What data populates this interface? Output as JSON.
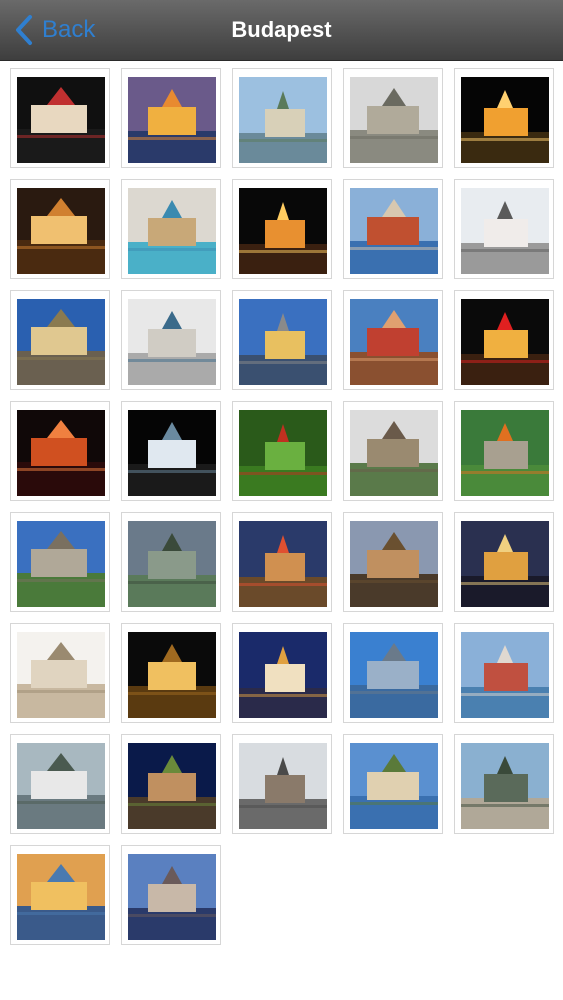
{
  "navbar": {
    "back_label": "Back",
    "title": "Budapest",
    "accent": "#2f7fd0"
  },
  "gallery": {
    "photos": [
      {
        "name": "parliament-night",
        "sky": "#101010",
        "ground": "#1a1a1a",
        "main": "#e8d8c0",
        "accent": "#c03030"
      },
      {
        "name": "danube-dusk",
        "sky": "#6a5a8a",
        "ground": "#2a3a6a",
        "main": "#f0b040",
        "accent": "#e88a30"
      },
      {
        "name": "buda-castle-river",
        "sky": "#9cc0e0",
        "ground": "#6a8a9a",
        "main": "#d8d0b8",
        "accent": "#5a7a5a"
      },
      {
        "name": "stone-tower",
        "sky": "#d8d8d8",
        "ground": "#8a8a80",
        "main": "#b0aa9a",
        "accent": "#6a6a60"
      },
      {
        "name": "matthias-church-night",
        "sky": "#050505",
        "ground": "#3a2a10",
        "main": "#f0a030",
        "accent": "#ffd070"
      },
      {
        "name": "gellert-baths-night",
        "sky": "#2a1a10",
        "ground": "#4a2a10",
        "main": "#f0c070",
        "accent": "#d08030"
      },
      {
        "name": "szechenyi-baths",
        "sky": "#dcd8d0",
        "ground": "#4ab0c8",
        "main": "#c8a878",
        "accent": "#3a8ab0"
      },
      {
        "name": "st-stephens-basilica-night",
        "sky": "#080808",
        "ground": "#3a2010",
        "main": "#e89030",
        "accent": "#ffcc60"
      },
      {
        "name": "river-panorama",
        "sky": "#8ab0d8",
        "ground": "#3a70b0",
        "main": "#c05030",
        "accent": "#d8c8b0"
      },
      {
        "name": "white-church",
        "sky": "#e8ecf0",
        "ground": "#9a9a9a",
        "main": "#f0ecea",
        "accent": "#5a5a5a"
      },
      {
        "name": "heroes-square-colonnade",
        "sky": "#2a60b0",
        "ground": "#6a6050",
        "main": "#e0c890",
        "accent": "#8a7a50"
      },
      {
        "name": "museum-columns",
        "sky": "#e8e8e8",
        "ground": "#aaaaaa",
        "main": "#d0ccc4",
        "accent": "#3a6a8a"
      },
      {
        "name": "modern-building-river",
        "sky": "#3a70c0",
        "ground": "#3a5070",
        "main": "#e8c060",
        "accent": "#8a8a8a"
      },
      {
        "name": "parliament-dome",
        "sky": "#4a80c0",
        "ground": "#8a5030",
        "main": "#c04030",
        "accent": "#e0a070"
      },
      {
        "name": "castle-laser-night",
        "sky": "#0a0a0a",
        "ground": "#3a2010",
        "main": "#f0b040",
        "accent": "#e02020"
      },
      {
        "name": "castle-hill-night",
        "sky": "#100808",
        "ground": "#2a0a0a",
        "main": "#d05020",
        "accent": "#f08040"
      },
      {
        "name": "dark-night-lights",
        "sky": "#050505",
        "ground": "#1a1a1a",
        "main": "#e0e8f0",
        "accent": "#6a8aa0"
      },
      {
        "name": "paprika-market",
        "sky": "#2a5a1a",
        "ground": "#3a7a20",
        "main": "#6ab040",
        "accent": "#c03020"
      },
      {
        "name": "stone-church",
        "sky": "#dcdcdc",
        "ground": "#5a7a4a",
        "main": "#9a8a70",
        "accent": "#6a5a4a"
      },
      {
        "name": "tunnel-entrance",
        "sky": "#3a7a3a",
        "ground": "#4a8a3a",
        "main": "#a8a090",
        "accent": "#e07020"
      },
      {
        "name": "statue",
        "sky": "#3a70c0",
        "ground": "#4a7a3a",
        "main": "#b0a898",
        "accent": "#7a7060"
      },
      {
        "name": "bridge-cloudy",
        "sky": "#6a7a8a",
        "ground": "#5a7a5a",
        "main": "#8a9a8a",
        "accent": "#3a4a3a"
      },
      {
        "name": "street-evening",
        "sky": "#2a3a6a",
        "ground": "#6a4a2a",
        "main": "#d09050",
        "accent": "#e05030"
      },
      {
        "name": "opera-facade",
        "sky": "#8a98b0",
        "ground": "#4a3a2a",
        "main": "#c09060",
        "accent": "#6a5030"
      },
      {
        "name": "chain-bridge-night",
        "sky": "#2a3050",
        "ground": "#1a1a2a",
        "main": "#e0a040",
        "accent": "#f0d080"
      },
      {
        "name": "fishermans-bastion",
        "sky": "#f4f2ee",
        "ground": "#c8b8a0",
        "main": "#e0d4c0",
        "accent": "#9a8a70"
      },
      {
        "name": "buda-castle-evening",
        "sky": "#0a0a0a",
        "ground": "#5a3a10",
        "main": "#f0c060",
        "accent": "#a06a20"
      },
      {
        "name": "parliament-dusk",
        "sky": "#1a2a6a",
        "ground": "#2a2a4a",
        "main": "#f0e0c0",
        "accent": "#e0a040"
      },
      {
        "name": "danube-blue-sky",
        "sky": "#3a80d0",
        "ground": "#3a6aa0",
        "main": "#9ab0c8",
        "accent": "#6a7a8a"
      },
      {
        "name": "parliament-across-river",
        "sky": "#8ab0d8",
        "ground": "#4a80b0",
        "main": "#c05040",
        "accent": "#e0d8d0"
      },
      {
        "name": "vintage-car-river",
        "sky": "#a8b8c0",
        "ground": "#6a7a80",
        "main": "#e8e8e8",
        "accent": "#4a5a50"
      },
      {
        "name": "palace-night-tree",
        "sky": "#0a1a4a",
        "ground": "#4a3a2a",
        "main": "#c09060",
        "accent": "#6a8a3a"
      },
      {
        "name": "railway-station",
        "sky": "#d8dce0",
        "ground": "#6a6a6a",
        "main": "#8a7a6a",
        "accent": "#4a4a4a"
      },
      {
        "name": "river-houses",
        "sky": "#5a90d0",
        "ground": "#3a70b0",
        "main": "#e0d0b0",
        "accent": "#5a7a3a"
      },
      {
        "name": "church-square",
        "sky": "#8ab0d0",
        "ground": "#b0a898",
        "main": "#5a6a5a",
        "accent": "#3a4a3a"
      },
      {
        "name": "bridge-sunset-reflection",
        "sky": "#e0a050",
        "ground": "#3a5a8a",
        "main": "#f0c060",
        "accent": "#4a7ab0"
      },
      {
        "name": "parliament-blue-reflection",
        "sky": "#5a80c0",
        "ground": "#2a3a6a",
        "main": "#c8b8a8",
        "accent": "#6a5a5a"
      }
    ]
  }
}
